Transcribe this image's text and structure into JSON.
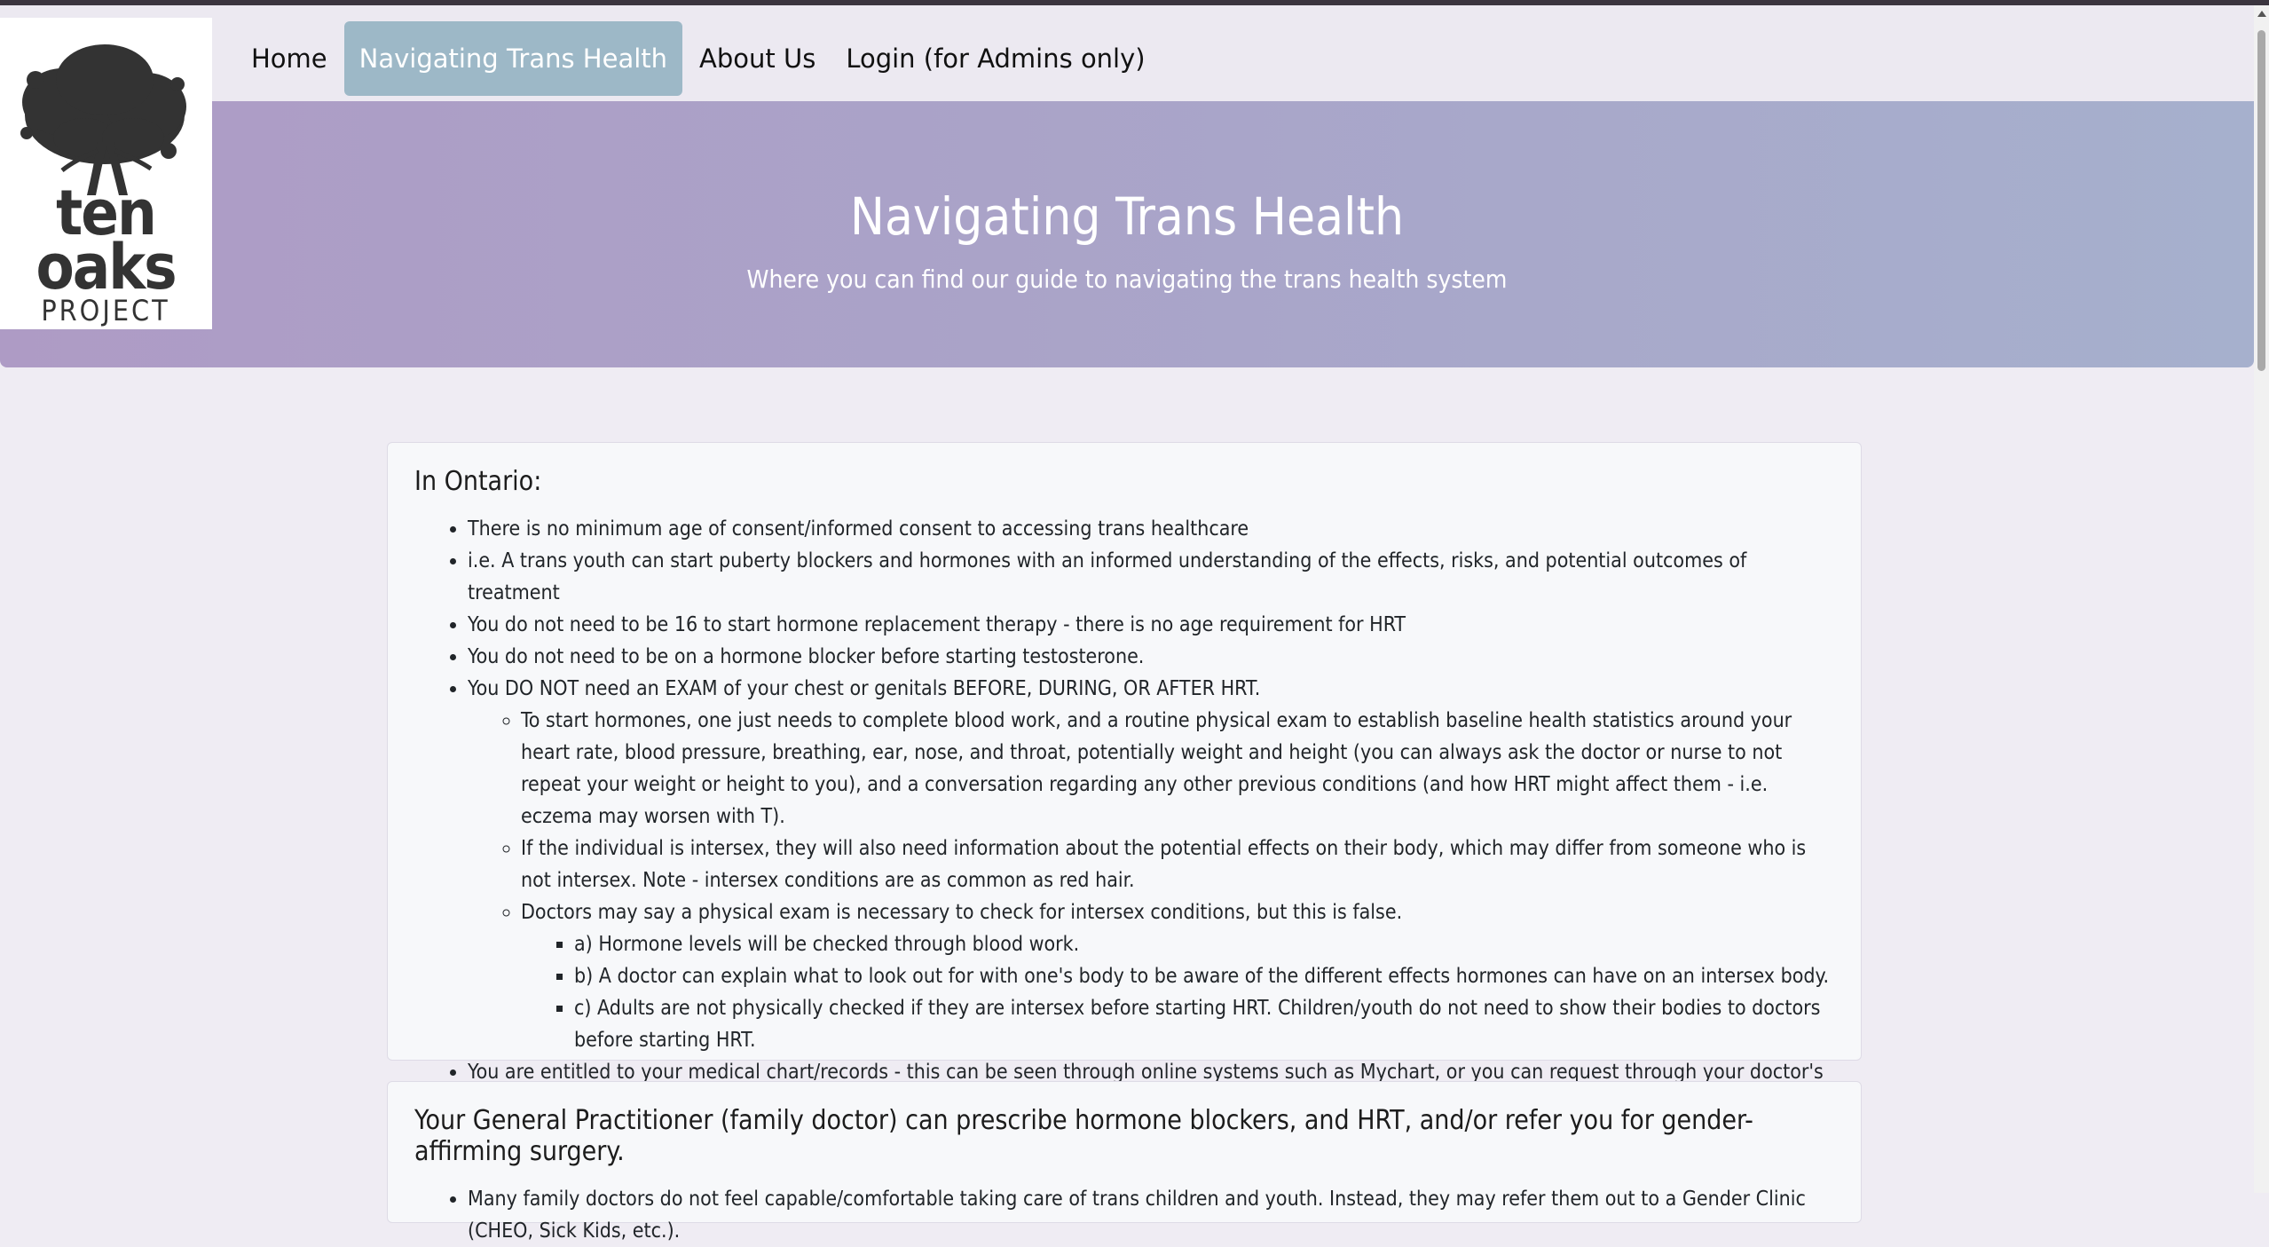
{
  "logo": {
    "line1": "ten",
    "line2": "oaks",
    "line3": "PROJECT"
  },
  "nav": {
    "items": [
      {
        "label": "Home"
      },
      {
        "label": "Navigating Trans Health"
      },
      {
        "label": "About Us"
      },
      {
        "label": "Login (for Admins only)"
      }
    ]
  },
  "hero": {
    "title": "Navigating Trans Health",
    "subtitle": "Where you can find our guide to navigating the trans health system"
  },
  "section1": {
    "heading": "In Ontario:",
    "items": [
      "There is no minimum age of consent/informed consent to accessing trans healthcare",
      "i.e. A trans youth can start puberty blockers and hormones with an informed understanding of the effects, risks, and potential outcomes of treatment",
      "You do not need to be 16 to start hormone replacement therapy - there is no age requirement for HRT",
      "You do not need to be on a hormone blocker before starting testosterone.",
      "You DO NOT need an EXAM of your chest or genitals BEFORE, DURING, OR AFTER HRT.",
      "You are entitled to your medical chart/records - this can be seen through online systems such as Mychart, or you can request through your doctor's office and staff should photocopy them for you"
    ],
    "subitems": [
      "To start hormones, one just needs to complete blood work, and a routine physical exam to establish baseline health statistics around your heart rate, blood pressure, breathing, ear, nose, and throat, potentially weight and height (you can always ask the doctor or nurse to not repeat your weight or height to you), and a conversation regarding any other previous conditions (and how HRT might affect them - i.e. eczema may worsen with T).",
      "If the individual is intersex, they will also need information about the potential effects on their body, which may differ from someone who is not intersex. Note - intersex conditions are as common as red hair.",
      "Doctors may say a physical exam is necessary to check for intersex conditions, but this is false."
    ],
    "subsubitems": [
      "a) Hormone levels will be checked through blood work.",
      "b) A doctor can explain what to look out for with one's body to be aware of the different effects hormones can have on an intersex body.",
      "c) Adults are not physically checked if they are intersex before starting HRT. Children/youth do not need to show their bodies to doctors before starting HRT."
    ]
  },
  "section2": {
    "heading": "Your General Practitioner (family doctor) can prescribe hormone blockers, and HRT, and/or refer you for gender-affirming surgery.",
    "items": [
      "Many family doctors do not feel capable/comfortable taking care of trans children and youth. Instead, they may refer them out to a Gender Clinic (CHEO, Sick Kids, etc.)."
    ]
  }
}
